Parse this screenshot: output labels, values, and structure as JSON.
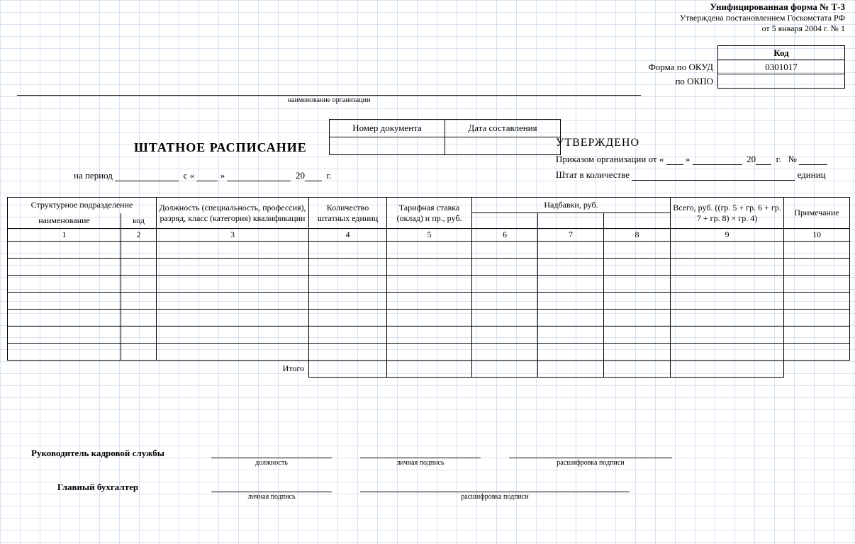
{
  "header": {
    "line1": "Унифицированная форма № Т-3",
    "line2": "Утверждена постановлением Госкомстата РФ",
    "line3": "от 5 января 2004 г. № 1"
  },
  "codes": {
    "kod_header": "Код",
    "okud_label": "Форма по ОКУД",
    "okud_value": "0301017",
    "okpo_label": "по ОКПО",
    "okpo_value": ""
  },
  "org_caption": "наименование организации",
  "doc_title": "ШТАТНОЕ РАСПИСАНИЕ",
  "doc_meta": {
    "num_header": "Номер документа",
    "date_header": "Дата составления",
    "num_value": "",
    "date_value": ""
  },
  "period": {
    "label": "на период",
    "from_label": "с «",
    "close_quote": "»",
    "year_prefix": "20",
    "year_suffix": "г."
  },
  "approved": {
    "title": "УТВЕРЖДЕНО",
    "line1_a": "Приказом организации от «",
    "line1_b": "»",
    "line1_year": "20",
    "line1_g": "г.",
    "line1_no": "№",
    "line2_a": "Штат в количестве",
    "line2_units": "единиц"
  },
  "table": {
    "col_struct": "Структурное подразделение",
    "col_struct_name": "наименование",
    "col_struct_code": "код",
    "col_position": "Должность (специальность, профессия), разряд, класс (категория) квалификации",
    "col_qty": "Количество штатных единиц",
    "col_rate": "Тарифная ставка (оклад) и пр., руб.",
    "col_allow": "Надбавки, руб.",
    "col_total": "Всего, руб. ((гр. 5 + гр. 6 + гр. 7 + гр. 8) × гр. 4)",
    "col_note": "Примечание",
    "nums": [
      "1",
      "2",
      "3",
      "4",
      "5",
      "6",
      "7",
      "8",
      "9",
      "10"
    ],
    "itogo": "Итого"
  },
  "sign": {
    "role1": "Руководитель кадровой службы",
    "role2": "Главный бухгалтер",
    "cap_position": "должность",
    "cap_sign": "личная подпись",
    "cap_decipher": "расшифровка подписи"
  }
}
